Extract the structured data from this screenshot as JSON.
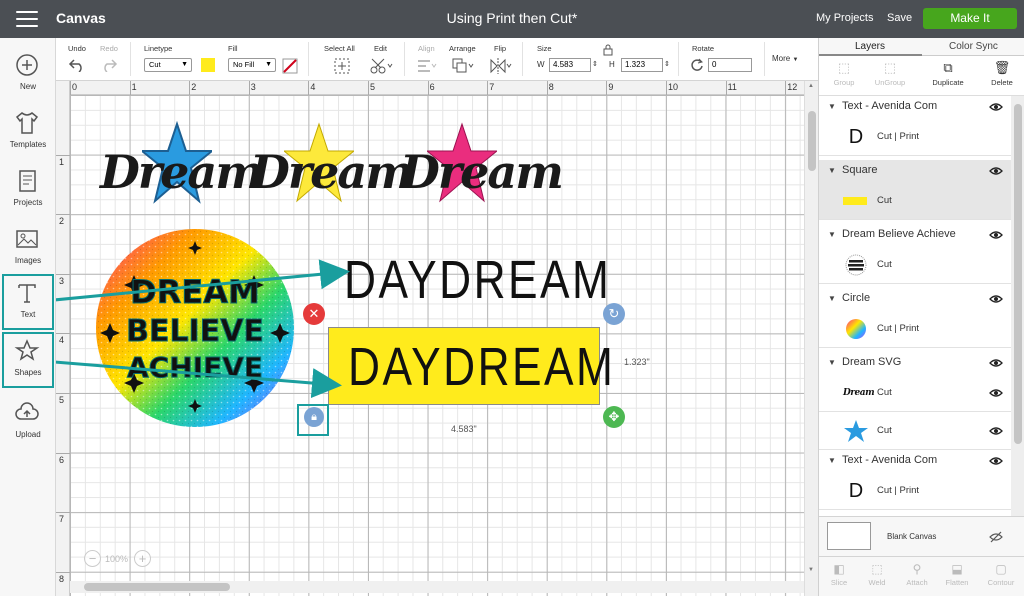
{
  "topbar": {
    "app_title": "Canvas",
    "doc_title": "Using Print then Cut*",
    "my_projects": "My Projects",
    "save": "Save",
    "make_it": "Make It"
  },
  "toolbar": {
    "undo": "Undo",
    "redo": "Redo",
    "linetype_label": "Linetype",
    "linetype_value": "Cut",
    "fill_label": "Fill",
    "fill_value": "No Fill",
    "select_all": "Select All",
    "edit": "Edit",
    "align": "Align",
    "arrange": "Arrange",
    "flip": "Flip",
    "size_label": "Size",
    "w_label": "W",
    "w_value": "4.583",
    "h_label": "H",
    "h_value": "1.323",
    "rotate_label": "Rotate",
    "rotate_value": "0",
    "more": "More",
    "linetype_color": "#ffeb1c"
  },
  "sidebar": {
    "items": [
      {
        "label": "New"
      },
      {
        "label": "Templates"
      },
      {
        "label": "Projects"
      },
      {
        "label": "Images"
      },
      {
        "label": "Text"
      },
      {
        "label": "Shapes"
      },
      {
        "label": "Upload"
      }
    ]
  },
  "canvas": {
    "ruler_top": [
      "0",
      "1",
      "2",
      "3",
      "4",
      "5",
      "6",
      "7",
      "8",
      "9",
      "10",
      "11",
      "12"
    ],
    "ruler_left": [
      "1",
      "2",
      "3",
      "4",
      "5",
      "6",
      "7",
      "8"
    ],
    "dream_words": [
      "Dream",
      "Dream",
      "Dream"
    ],
    "badge_lines": [
      "DREAM",
      "BELIEVE",
      "ACHIEVE"
    ],
    "daydream_text": "DAYDREAM",
    "daydream_selected_text": "DAYDREAM",
    "height_label": "1.323\"",
    "width_label": "4.583\"",
    "zoom": "100%",
    "colors": {
      "star_blue": "#2a9be0",
      "star_yellow": "#fde93b",
      "star_pink": "#ea2d7e",
      "selection_fill": "#ffeb1c",
      "annotation": "#1a9e9e"
    }
  },
  "panel": {
    "tabs": [
      "Layers",
      "Color Sync"
    ],
    "actions": [
      "Group",
      "UnGroup",
      "Duplicate",
      "Delete"
    ],
    "layers": [
      {
        "name": "Text - Avenida Com",
        "rows": [
          {
            "op": "Cut  |  Print"
          }
        ]
      },
      {
        "name": "Square",
        "rows": [
          {
            "op": "Cut"
          }
        ]
      },
      {
        "name": "Dream Believe Achieve",
        "rows": [
          {
            "op": "Cut"
          }
        ]
      },
      {
        "name": "Circle",
        "rows": [
          {
            "op": "Cut  |  Print"
          }
        ]
      },
      {
        "name": "Dream SVG",
        "rows": [
          {
            "op": "Cut"
          },
          {
            "op": "Cut"
          }
        ]
      },
      {
        "name": "Text - Avenida Com",
        "rows": [
          {
            "op": "Cut  |  Print"
          }
        ]
      }
    ],
    "blank_canvas": "Blank Canvas",
    "bottom_actions": [
      "Slice",
      "Weld",
      "Attach",
      "Flatten",
      "Contour"
    ],
    "thumb_text": "Dream"
  }
}
